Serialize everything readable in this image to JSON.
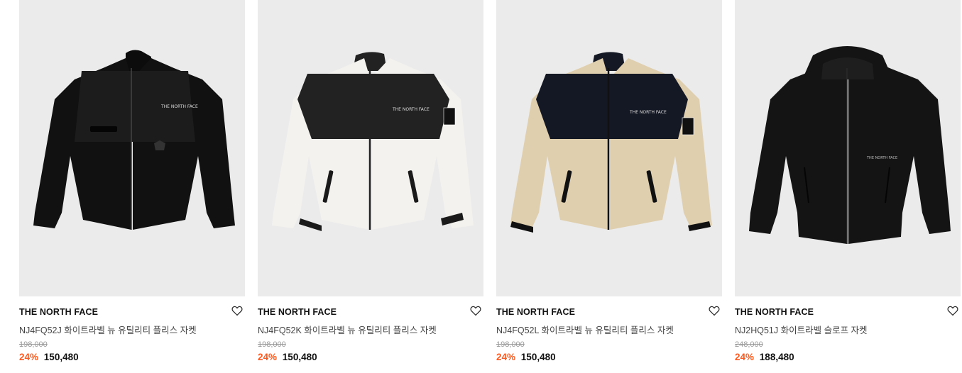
{
  "products": [
    {
      "brand": "THE NORTH FACE",
      "name": "NJ4FQ52J 화이트라벨 뉴 유틸리티 플리스 자켓",
      "original_price": "198,000",
      "discount": "24%",
      "sale_price": "150,480",
      "image_icon": "black-fleece-jacket-image",
      "colors": {
        "body": "#111111",
        "yoke": "#151515",
        "trim": "#000000"
      }
    },
    {
      "brand": "THE NORTH FACE",
      "name": "NJ4FQ52K 화이트라벨 뉴 유틸리티 플리스 자켓",
      "original_price": "198,000",
      "discount": "24%",
      "sale_price": "150,480",
      "image_icon": "white-fleece-jacket-image",
      "colors": {
        "body": "#f4f2ee",
        "yoke": "#222222",
        "trim": "#1a1a1a"
      }
    },
    {
      "brand": "THE NORTH FACE",
      "name": "NJ4FQ52L 화이트라벨 뉴 유틸리티 플리스 자켓",
      "original_price": "198,000",
      "discount": "24%",
      "sale_price": "150,480",
      "image_icon": "beige-fleece-jacket-image",
      "colors": {
        "body": "#e0cfae",
        "yoke": "#141824",
        "trim": "#111111"
      }
    },
    {
      "brand": "THE NORTH FACE",
      "name": "NJ2HQ51J 화이트라벨 슬로프 자켓",
      "original_price": "248,000",
      "discount": "24%",
      "sale_price": "188,480",
      "image_icon": "black-hooded-jacket-image",
      "colors": {
        "body": "#141414",
        "yoke": "#141414",
        "trim": "#050505"
      }
    }
  ],
  "accent_color": "#ff5a1f"
}
